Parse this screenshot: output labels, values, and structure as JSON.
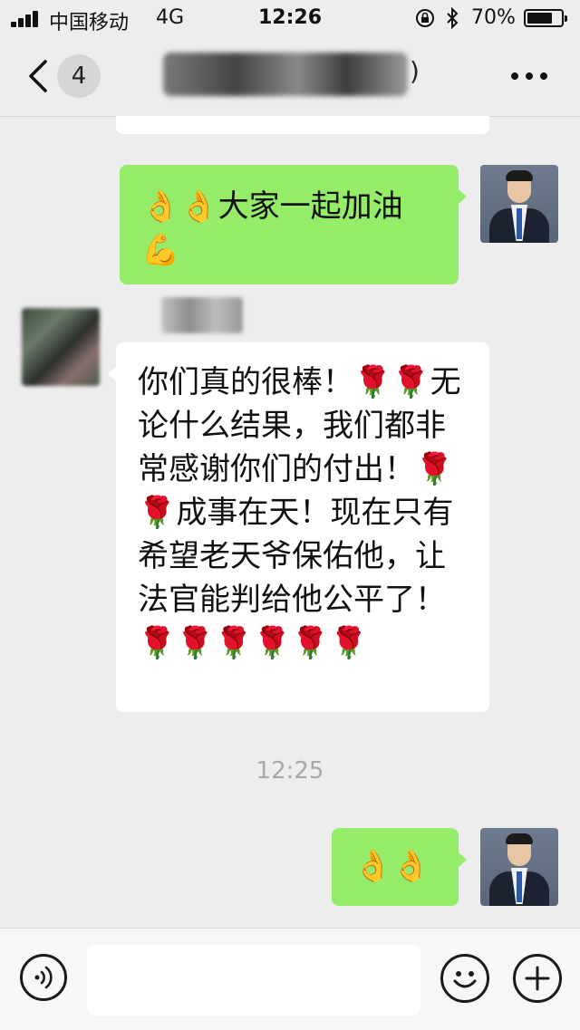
{
  "status_bar": {
    "carrier": "中国移动",
    "network": "4G",
    "time": "12:26",
    "battery_percent": "70%"
  },
  "nav": {
    "unread_count": "4",
    "title_suffix": ")"
  },
  "messages": [
    {
      "side": "right",
      "text": "👌👌大家一起加油💪"
    },
    {
      "side": "left",
      "text": "你们真的很棒！🌹🌹无论什么结果，我们都非常感谢你们的付出！🌹🌹成事在天！现在只有希望老天爷保佑他，让法官能判给他公平了！🌹🌹🌹🌹🌹🌹"
    },
    {
      "side": "right",
      "text": "👌👌"
    }
  ],
  "time_separator": "12:25",
  "input": {
    "placeholder": ""
  },
  "colors": {
    "background": "#ededed",
    "green_bubble": "#95ec69",
    "white_bubble": "#ffffff",
    "timestamp": "#a8a8a8"
  },
  "icons": [
    "signal-icon",
    "lock-rotation-icon",
    "bluetooth-icon",
    "battery-icon",
    "back-icon",
    "more-icon",
    "voice-icon",
    "emoji-icon",
    "plus-icon"
  ]
}
